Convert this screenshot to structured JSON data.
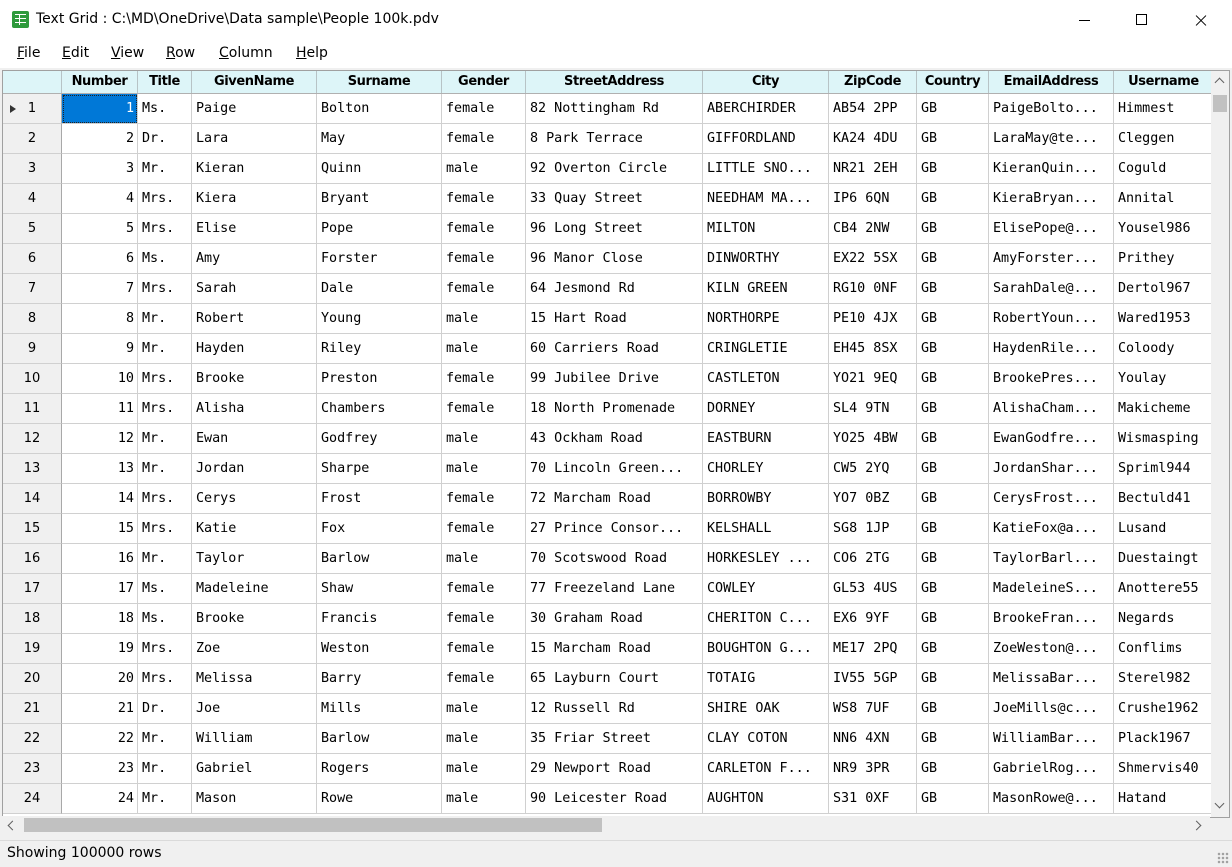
{
  "window": {
    "title": "Text Grid : C:\\MD\\OneDrive\\Data sample\\People 100k.pdv"
  },
  "menu": [
    {
      "first": "F",
      "rest": "ile"
    },
    {
      "first": "E",
      "rest": "dit"
    },
    {
      "first": "V",
      "rest": "iew"
    },
    {
      "first": "R",
      "rest": "ow"
    },
    {
      "first": "C",
      "rest": "olumn"
    },
    {
      "first": "H",
      "rest": "elp"
    }
  ],
  "table": {
    "columns": [
      "Number",
      "Title",
      "GivenName",
      "Surname",
      "Gender",
      "StreetAddress",
      "City",
      "ZipCode",
      "Country",
      "EmailAddress",
      "Username"
    ],
    "rows": [
      [
        "1",
        "Ms.",
        "Paige",
        "Bolton",
        "female",
        "82 Nottingham Rd",
        "ABERCHIRDER",
        "AB54 2PP",
        "GB",
        "PaigeBolto...",
        "Himmest"
      ],
      [
        "2",
        "Dr.",
        "Lara",
        "May",
        "female",
        "8 Park Terrace",
        "GIFFORDLAND",
        "KA24 4DU",
        "GB",
        "LaraMay@te...",
        "Cleggen"
      ],
      [
        "3",
        "Mr.",
        "Kieran",
        "Quinn",
        "male",
        "92 Overton Circle",
        "LITTLE SNO...",
        "NR21 2EH",
        "GB",
        "KieranQuin...",
        "Coguld"
      ],
      [
        "4",
        "Mrs.",
        "Kiera",
        "Bryant",
        "female",
        "33 Quay Street",
        "NEEDHAM MA...",
        "IP6 6QN",
        "GB",
        "KieraBryan...",
        "Annital"
      ],
      [
        "5",
        "Mrs.",
        "Elise",
        "Pope",
        "female",
        "96 Long Street",
        "MILTON",
        "CB4 2NW",
        "GB",
        "ElisePope@...",
        "Yousel986"
      ],
      [
        "6",
        "Ms.",
        "Amy",
        "Forster",
        "female",
        "96 Manor Close",
        "DINWORTHY",
        "EX22 5SX",
        "GB",
        "AmyForster...",
        "Prithey"
      ],
      [
        "7",
        "Mrs.",
        "Sarah",
        "Dale",
        "female",
        "64 Jesmond Rd",
        "KILN GREEN",
        "RG10 0NF",
        "GB",
        "SarahDale@...",
        "Dertol967"
      ],
      [
        "8",
        "Mr.",
        "Robert",
        "Young",
        "male",
        "15 Hart Road",
        "NORTHORPE",
        "PE10 4JX",
        "GB",
        "RobertYoun...",
        "Wared1953"
      ],
      [
        "9",
        "Mr.",
        "Hayden",
        "Riley",
        "male",
        "60 Carriers Road",
        "CRINGLETIE",
        "EH45 8SX",
        "GB",
        "HaydenRile...",
        "Coloody"
      ],
      [
        "10",
        "Mrs.",
        "Brooke",
        "Preston",
        "female",
        "99 Jubilee Drive",
        "CASTLETON",
        "YO21 9EQ",
        "GB",
        "BrookePres...",
        "Youlay"
      ],
      [
        "11",
        "Mrs.",
        "Alisha",
        "Chambers",
        "female",
        "18 North Promenade",
        "DORNEY",
        "SL4 9TN",
        "GB",
        "AlishaCham...",
        "Makicheme"
      ],
      [
        "12",
        "Mr.",
        "Ewan",
        "Godfrey",
        "male",
        "43 Ockham Road",
        "EASTBURN",
        "YO25 4BW",
        "GB",
        "EwanGodfre...",
        "Wismasping"
      ],
      [
        "13",
        "Mr.",
        "Jordan",
        "Sharpe",
        "male",
        "70 Lincoln Green...",
        "CHORLEY",
        "CW5 2YQ",
        "GB",
        "JordanShar...",
        "Spriml944"
      ],
      [
        "14",
        "Mrs.",
        "Cerys",
        "Frost",
        "female",
        "72 Marcham Road",
        "BORROWBY",
        "YO7 0BZ",
        "GB",
        "CerysFrost...",
        "Bectuld41"
      ],
      [
        "15",
        "Mrs.",
        "Katie",
        "Fox",
        "female",
        "27 Prince Consor...",
        "KELSHALL",
        "SG8 1JP",
        "GB",
        "KatieFox@a...",
        "Lusand"
      ],
      [
        "16",
        "Mr.",
        "Taylor",
        "Barlow",
        "male",
        "70 Scotswood Road",
        "HORKESLEY ...",
        "CO6 2TG",
        "GB",
        "TaylorBarl...",
        "Duestaingt"
      ],
      [
        "17",
        "Ms.",
        "Madeleine",
        "Shaw",
        "female",
        "77 Freezeland Lane",
        "COWLEY",
        "GL53 4US",
        "GB",
        "MadeleineS...",
        "Anottere55"
      ],
      [
        "18",
        "Ms.",
        "Brooke",
        "Francis",
        "female",
        "30 Graham Road",
        "CHERITON C...",
        "EX6 9YF",
        "GB",
        "BrookeFran...",
        "Negards"
      ],
      [
        "19",
        "Mrs.",
        "Zoe",
        "Weston",
        "female",
        "15 Marcham Road",
        "BOUGHTON G...",
        "ME17 2PQ",
        "GB",
        "ZoeWeston@...",
        "Conflims"
      ],
      [
        "20",
        "Mrs.",
        "Melissa",
        "Barry",
        "female",
        "65 Layburn Court",
        "TOTAIG",
        "IV55 5GP",
        "GB",
        "MelissaBar...",
        "Sterel982"
      ],
      [
        "21",
        "Dr.",
        "Joe",
        "Mills",
        "male",
        "12 Russell Rd",
        "SHIRE OAK",
        "WS8 7UF",
        "GB",
        "JoeMills@c...",
        "Crushe1962"
      ],
      [
        "22",
        "Mr.",
        "William",
        "Barlow",
        "male",
        "35 Friar Street",
        "CLAY COTON",
        "NN6 4XN",
        "GB",
        "WilliamBar...",
        "Plack1967"
      ],
      [
        "23",
        "Mr.",
        "Gabriel",
        "Rogers",
        "male",
        "29 Newport Road",
        "CARLETON F...",
        "NR9 3PR",
        "GB",
        "GabrielRog...",
        "Shmervis40"
      ],
      [
        "24",
        "Mr.",
        "Mason",
        "Rowe",
        "male",
        "90 Leicester Road",
        "AUGHTON",
        "S31 0XF",
        "GB",
        "MasonRowe@...",
        "Hatand"
      ]
    ],
    "row_numbers": [
      "1",
      "2",
      "3",
      "4",
      "5",
      "6",
      "7",
      "8",
      "9",
      "10",
      "11",
      "12",
      "13",
      "14",
      "15",
      "16",
      "17",
      "18",
      "19",
      "20",
      "21",
      "22",
      "23",
      "24"
    ]
  },
  "status": {
    "text": "Showing 100000 rows"
  },
  "colors": {
    "header_bg": "#ddf5f8",
    "selection": "#0078d7",
    "app_icon": "#2e9a3c"
  },
  "icons": {
    "app": "grid-app-icon",
    "minimize": "minimize-icon",
    "maximize": "maximize-icon",
    "close": "close-icon"
  }
}
